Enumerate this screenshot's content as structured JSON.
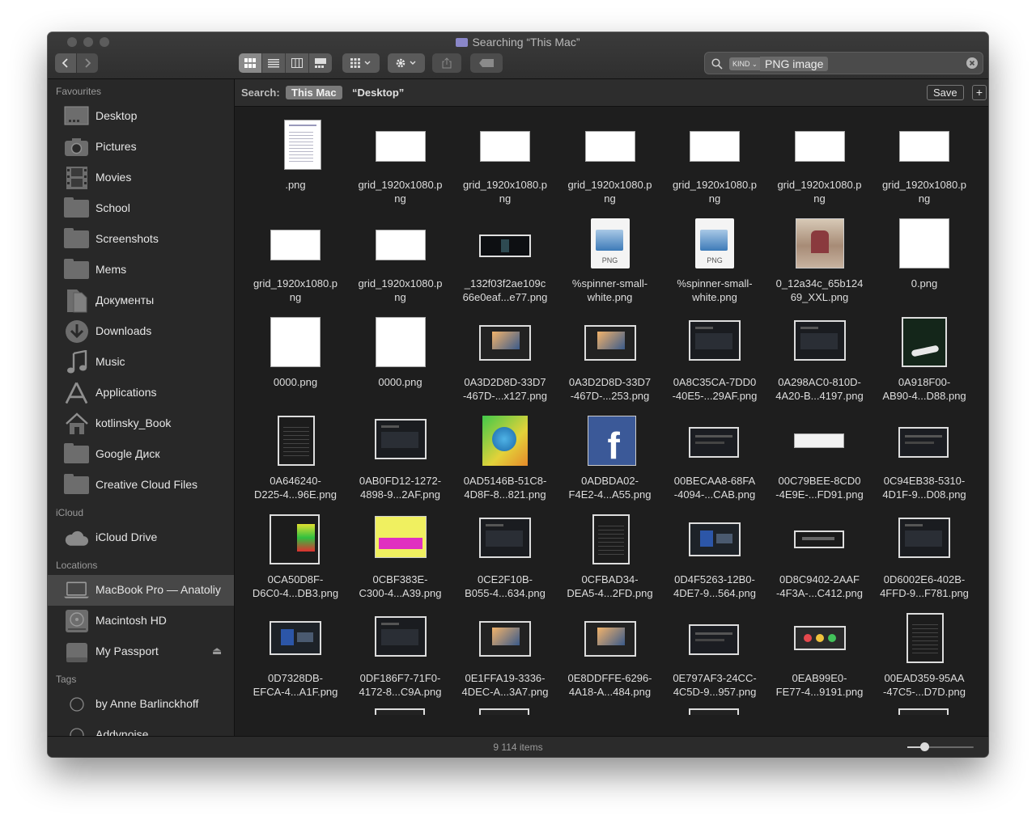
{
  "window": {
    "title": "Searching “This Mac”",
    "status": "9 114 items"
  },
  "toolbar": {
    "search": {
      "kind_token": "KIND",
      "value": "PNG image"
    }
  },
  "scope": {
    "label": "Search:",
    "this_mac": "This Mac",
    "desktop": "“Desktop”",
    "save": "Save",
    "add": "+"
  },
  "sidebar": {
    "sections": [
      {
        "name": "Favourites",
        "items": [
          {
            "label": "Desktop",
            "icon": "desktop-icon"
          },
          {
            "label": "Pictures",
            "icon": "camera-icon"
          },
          {
            "label": "Movies",
            "icon": "film-icon"
          },
          {
            "label": "School",
            "icon": "folder-icon"
          },
          {
            "label": "Screenshots",
            "icon": "folder-icon"
          },
          {
            "label": "Mems",
            "icon": "folder-icon"
          },
          {
            "label": "Документы",
            "icon": "documents-icon"
          },
          {
            "label": "Downloads",
            "icon": "download-icon"
          },
          {
            "label": "Music",
            "icon": "music-icon"
          },
          {
            "label": "Applications",
            "icon": "applications-icon"
          },
          {
            "label": "kotlinsky_Book",
            "icon": "home-icon"
          },
          {
            "label": "Google Диск",
            "icon": "folder-icon"
          },
          {
            "label": "Creative Cloud Files",
            "icon": "folder-icon"
          }
        ]
      },
      {
        "name": "iCloud",
        "items": [
          {
            "label": "iCloud Drive",
            "icon": "cloud-icon"
          }
        ]
      },
      {
        "name": "Locations",
        "items": [
          {
            "label": "MacBook Pro — Anatoliy",
            "icon": "laptop-icon",
            "selected": true
          },
          {
            "label": "Macintosh HD",
            "icon": "hard-drive-icon"
          },
          {
            "label": "My Passport",
            "icon": "external-drive-icon",
            "eject": "⏏"
          }
        ]
      },
      {
        "name": "Tags",
        "items": [
          {
            "label": "by Anne Barlinckhoff",
            "icon": "tag-icon"
          },
          {
            "label": "Addynoise",
            "icon": "tag-icon"
          }
        ]
      }
    ]
  },
  "files": [
    {
      "line1": ".png",
      "line2": "",
      "thumb": "doc"
    },
    {
      "line1": "grid_1920x1080.p",
      "line2": "ng",
      "thumb": "white-wide"
    },
    {
      "line1": "grid_1920x1080.p",
      "line2": "ng",
      "thumb": "white-wide"
    },
    {
      "line1": "grid_1920x1080.p",
      "line2": "ng",
      "thumb": "white-wide"
    },
    {
      "line1": "grid_1920x1080.p",
      "line2": "ng",
      "thumb": "white-wide"
    },
    {
      "line1": "grid_1920x1080.p",
      "line2": "ng",
      "thumb": "white-wide"
    },
    {
      "line1": "grid_1920x1080.p",
      "line2": "ng",
      "thumb": "white-wide"
    },
    {
      "line1": "grid_1920x1080.p",
      "line2": "ng",
      "thumb": "white-wide"
    },
    {
      "line1": "grid_1920x1080.p",
      "line2": "ng",
      "thumb": "white-wide"
    },
    {
      "line1": "_132f03f2ae109c",
      "line2": "66e0eaf...e77.png",
      "thumb": "dark-strip"
    },
    {
      "line1": "%spinner-small-",
      "line2": "white.png",
      "thumb": "png-icon",
      "badge": "PNG"
    },
    {
      "line1": "%spinner-small-",
      "line2": "white.png",
      "thumb": "png-icon",
      "badge": "PNG"
    },
    {
      "line1": "0_12a34c_65b124",
      "line2": "69_XXL.png",
      "thumb": "photo"
    },
    {
      "line1": "0.png",
      "line2": "",
      "thumb": "white-square"
    },
    {
      "line1": "0000.png",
      "line2": "",
      "thumb": "white-square"
    },
    {
      "line1": "0000.png",
      "line2": "",
      "thumb": "white-square"
    },
    {
      "line1": "0A3D2D8D-33D7",
      "line2": "-467D-...x127.png",
      "thumb": "screen-photo"
    },
    {
      "line1": "0A3D2D8D-33D7",
      "line2": "-467D-...253.png",
      "thumb": "screen-photo"
    },
    {
      "line1": "0A8C35CA-7DD0",
      "line2": "-40E5-...29AF.png",
      "thumb": "screen-dark"
    },
    {
      "line1": "0A298AC0-810D-",
      "line2": "4A20-B...4197.png",
      "thumb": "screen-dark"
    },
    {
      "line1": "0A918F00-",
      "line2": "AB90-4...D88.png",
      "thumb": "screen-green"
    },
    {
      "line1": "0A646240-",
      "line2": "D225-4...96E.png",
      "thumb": "screen-tall"
    },
    {
      "line1": "0AB0FD12-1272-",
      "line2": "4898-9...2AF.png",
      "thumb": "screen-dark"
    },
    {
      "line1": "0AD5146B-51C8-",
      "line2": "4D8F-8...821.png",
      "thumb": "globe"
    },
    {
      "line1": "0ADBDA02-",
      "line2": "F4E2-4...A55.png",
      "thumb": "facebook",
      "glyph": "f"
    },
    {
      "line1": "00BECAA8-68FA",
      "line2": "-4094-...CAB.png",
      "thumb": "screen-wide-dark"
    },
    {
      "line1": "00C79BEE-8CD0",
      "line2": "-4E9E-...FD91.png",
      "thumb": "light-bar"
    },
    {
      "line1": "0C94EB38-5310-",
      "line2": "4D1F-9...D08.png",
      "thumb": "screen-wide-dark"
    },
    {
      "line1": "0CA50D8F-",
      "line2": "D6C0-4...DB3.png",
      "thumb": "screen-colors"
    },
    {
      "line1": "0CBF383E-",
      "line2": "C300-4...A39.png",
      "thumb": "yellow"
    },
    {
      "line1": "0CE2F10B-",
      "line2": "B055-4...634.png",
      "thumb": "screen-dark"
    },
    {
      "line1": "0CFBAD34-",
      "line2": "DEA5-4...2FD.png",
      "thumb": "screen-tall"
    },
    {
      "line1": "0D4F5263-12B0-",
      "line2": "4DE7-9...564.png",
      "thumb": "screen-wide-blue"
    },
    {
      "line1": "0D8C9402-2AAF",
      "line2": "-4F3A-...C412.png",
      "thumb": "light-bar-dark"
    },
    {
      "line1": "0D6002E6-402B-",
      "line2": "4FFD-9...F781.png",
      "thumb": "screen-dark"
    },
    {
      "line1": "0D7328DB-",
      "line2": "EFCA-4...A1F.png",
      "thumb": "screen-wide-blue"
    },
    {
      "line1": "0DF186F7-71F0-",
      "line2": "4172-8...C9A.png",
      "thumb": "screen-dark"
    },
    {
      "line1": "0E1FFA19-3336-",
      "line2": "4DEC-A...3A7.png",
      "thumb": "screen-photo"
    },
    {
      "line1": "0E8DDFFE-6296-",
      "line2": "4A18-A...484.png",
      "thumb": "screen-photo"
    },
    {
      "line1": "0E797AF3-24CC-",
      "line2": "4C5D-9...957.png",
      "thumb": "screen-wide-dark"
    },
    {
      "line1": "0EAB99E0-",
      "line2": "FE77-4...9191.png",
      "thumb": "traffic-lights"
    },
    {
      "line1": "00EAD359-95AA",
      "line2": "-47C5-...D7D.png",
      "thumb": "screen-tall"
    }
  ],
  "colors": {
    "window_bg": "#1e1e1e",
    "sidebar_bg": "#282828",
    "selection": "#474747",
    "text": "#e6e6e6"
  }
}
